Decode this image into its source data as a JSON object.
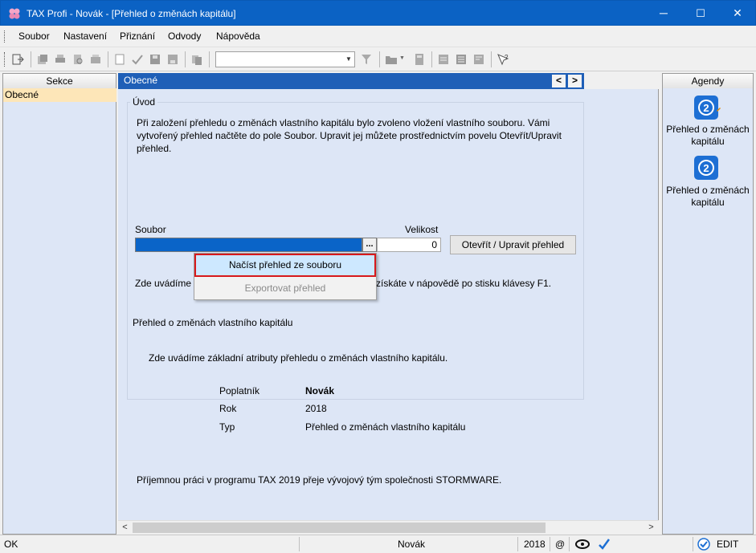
{
  "window": {
    "title": "TAX Profi - Novák - [Přehled o změnách kapitálu]",
    "minimize": "─",
    "maximize": "☐",
    "close": "✕"
  },
  "menu": {
    "items": [
      {
        "label": "Soubor",
        "accel": "S"
      },
      {
        "label": "Nastavení",
        "accel": "N"
      },
      {
        "label": "Přiznání",
        "accel": "P"
      },
      {
        "label": "Odvody",
        "accel": "O"
      },
      {
        "label": "Nápověda",
        "accel": "N"
      }
    ]
  },
  "toolbar": {
    "combo_value": ""
  },
  "sekce": {
    "header": "Sekce",
    "items": [
      "Obecné"
    ]
  },
  "main": {
    "header": "Obecné",
    "nav_prev": "<",
    "nav_next": ">",
    "uvod": {
      "label": "Úvod",
      "text": "Při založení přehledu o změnách vlastního kapitálu bylo zvoleno vložení vlastního souboru. Vámi vytvořený přehled načtěte do pole Soubor. Upravit jej můžete prostřednictvím povelu Otevřít/Upravit přehled."
    },
    "soubor_label": "Soubor",
    "velikost_label": "Velikost",
    "velikost_value": "0",
    "ellipsis": "...",
    "open_button": "Otevřít / Upravit přehled",
    "help_text_left": "Zde uvádíme",
    "help_text_right": "získáte v nápovědě po stisku klávesy F1.",
    "context_menu": {
      "load": "Načíst přehled ze souboru",
      "export": "Exportovat přehled"
    },
    "prehled": {
      "label": "Přehled o změnách vlastního kapitálu",
      "intro": "Zde uvádíme základní atributy přehledu o změnách vlastního kapitálu.",
      "rows": [
        {
          "key": "Poplatník",
          "value": "Novák"
        },
        {
          "key": "Rok",
          "value": "2018"
        },
        {
          "key": "Typ",
          "value": "Přehled o změnách vlastního kapitálu"
        }
      ],
      "footer": "Příjemnou práci v programu TAX 2019 přeje vývojový tým společnosti STORMWARE."
    }
  },
  "agendy": {
    "header": "Agendy",
    "items": [
      {
        "label": "Přehled o změnách kapitálu"
      },
      {
        "label": "Přehled o změnách kapitálu"
      }
    ]
  },
  "status": {
    "left": "OK",
    "user": "Novák",
    "year": "2018",
    "at": "@",
    "mode": "EDIT"
  },
  "colors": {
    "accent": "#0b62c4",
    "panel_bg": "#dde6f6",
    "highlight": "#d7191c"
  }
}
